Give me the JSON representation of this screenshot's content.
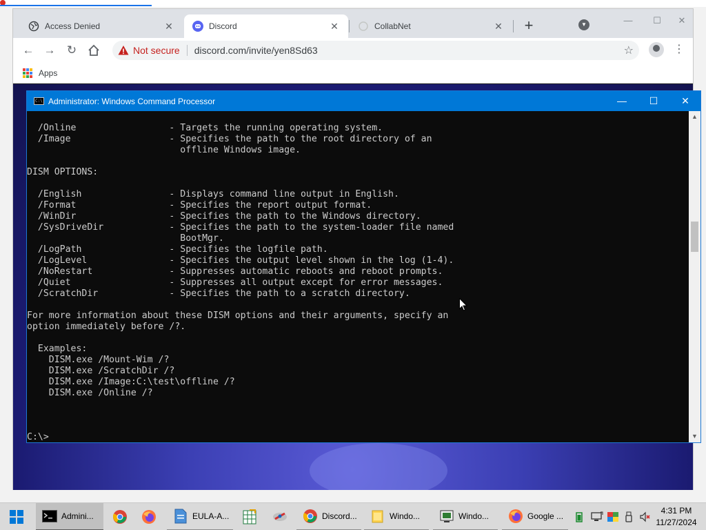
{
  "browser": {
    "tabs": [
      {
        "label": "Access Denied",
        "icon": "globe-icon",
        "active": false
      },
      {
        "label": "Discord",
        "icon": "discord-icon",
        "active": true
      },
      {
        "label": "CollabNet",
        "icon": "loading-icon",
        "active": false
      }
    ],
    "address": {
      "security_label": "Not secure",
      "url": "discord.com/invite/yen8Sd63"
    },
    "bookmarks": [
      {
        "label": "Apps"
      }
    ],
    "colors": {
      "accent": "#1a73e8",
      "insecure": "#c5221f",
      "discord": "#5865f2"
    }
  },
  "cmd": {
    "title": "Administrator: Windows Command Processor",
    "lines": [
      "  /Online                 - Targets the running operating system.",
      "  /Image                  - Specifies the path to the root directory of an",
      "                            offline Windows image.",
      "",
      "DISM OPTIONS:",
      "",
      "  /English                - Displays command line output in English.",
      "  /Format                 - Specifies the report output format.",
      "  /WinDir                 - Specifies the path to the Windows directory.",
      "  /SysDriveDir            - Specifies the path to the system-loader file named",
      "                            BootMgr.",
      "  /LogPath                - Specifies the logfile path.",
      "  /LogLevel               - Specifies the output level shown in the log (1-4).",
      "  /NoRestart              - Suppresses automatic reboots and reboot prompts.",
      "  /Quiet                  - Suppresses all output except for error messages.",
      "  /ScratchDir             - Specifies the path to a scratch directory.",
      "",
      "For more information about these DISM options and their arguments, specify an",
      "option immediately before /?.",
      "",
      "  Examples:",
      "    DISM.exe /Mount-Wim /?",
      "    DISM.exe /ScratchDir /?",
      "    DISM.exe /Image:C:\\test\\offline /?",
      "    DISM.exe /Online /?",
      "",
      "",
      "",
      "C:\\>"
    ],
    "colors": {
      "titlebar": "#0078d7",
      "background": "#0c0c0c",
      "text": "#cccccc"
    }
  },
  "taskbar": {
    "items": [
      {
        "label": "Admini...",
        "icon": "cmd-icon",
        "state": "active"
      },
      {
        "label": "",
        "icon": "chrome-icon",
        "state": "pinned"
      },
      {
        "label": "",
        "icon": "firefox-icon",
        "state": "pinned"
      },
      {
        "label": "EULA-A...",
        "icon": "document-icon",
        "state": "open"
      },
      {
        "label": "",
        "icon": "spreadsheet-icon",
        "state": "pinned"
      },
      {
        "label": "",
        "icon": "tool-icon",
        "state": "pinned"
      },
      {
        "label": "Discord...",
        "icon": "chrome-icon",
        "state": "open"
      },
      {
        "label": "Windo...",
        "icon": "folder-icon",
        "state": "open"
      },
      {
        "label": "Windo...",
        "icon": "windows-app-icon",
        "state": "open"
      },
      {
        "label": "Google ...",
        "icon": "firefox-icon",
        "state": "open"
      }
    ],
    "tray_icons": [
      "battery-icon",
      "network-icon",
      "color-icon",
      "usb-icon",
      "volume-muted-icon"
    ],
    "clock": {
      "time": "4:31 PM",
      "date": "11/27/2024"
    }
  }
}
